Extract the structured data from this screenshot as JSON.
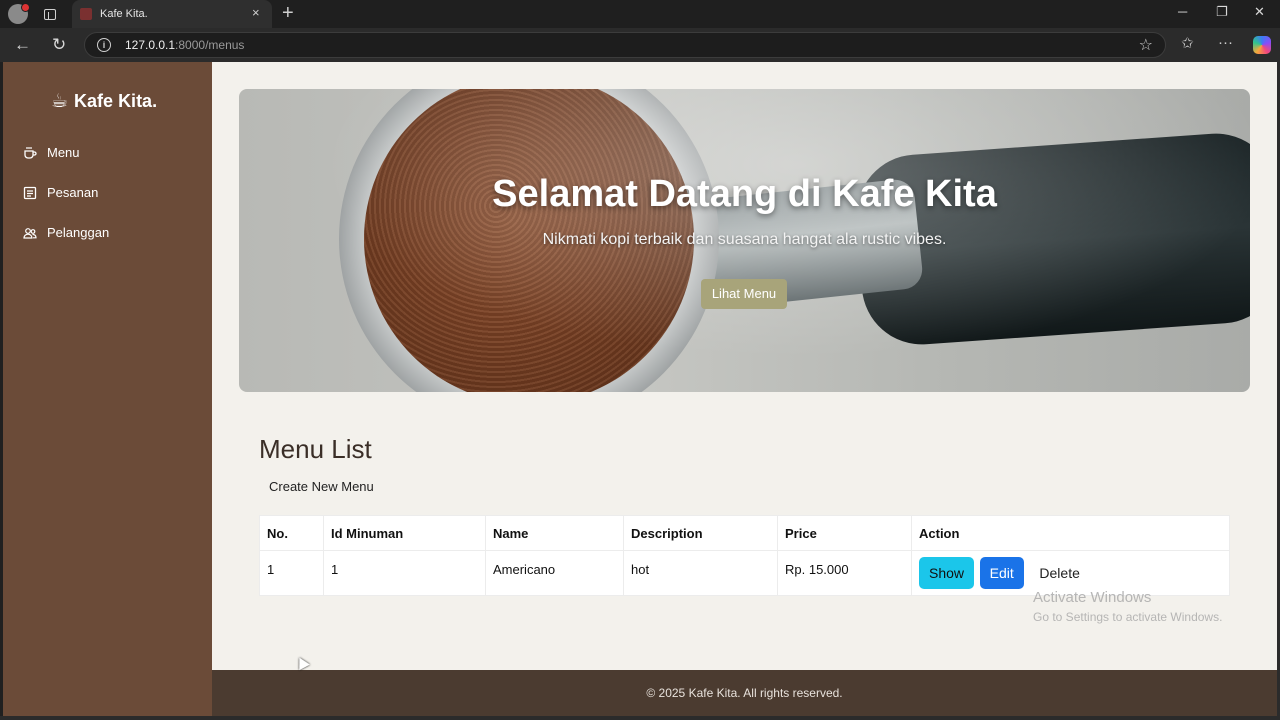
{
  "browser": {
    "tab_title": "Kafe Kita.",
    "tab_close": "×",
    "new_tab": "+",
    "url_host": "127.0.0.1",
    "url_rest": ":8000/menus",
    "info": "i",
    "star": "☆",
    "back": "←",
    "reload": "↻",
    "minimize": "─",
    "restore": "❐",
    "close": "✕",
    "favorites": "✩",
    "more": "···"
  },
  "sidebar": {
    "brand": "Kafe Kita.",
    "items": [
      {
        "label": "Menu",
        "icon": "coffee-cup-icon"
      },
      {
        "label": "Pesanan",
        "icon": "list-icon"
      },
      {
        "label": "Pelanggan",
        "icon": "users-icon"
      }
    ]
  },
  "hero": {
    "title": "Selamat Datang di Kafe Kita",
    "subtitle": "Nikmati kopi terbaik dan suasana hangat ala rustic vibes.",
    "button": "Lihat Menu"
  },
  "main": {
    "title": "Menu List",
    "create_link": "Create New Menu",
    "table": {
      "headers": [
        "No.",
        "Id Minuman",
        "Name",
        "Description",
        "Price",
        "Action"
      ],
      "rows": [
        {
          "no": "1",
          "id": "1",
          "name": "Americano",
          "description": "hot",
          "price": "Rp. 15.000"
        }
      ],
      "actions": {
        "show": "Show",
        "edit": "Edit",
        "delete": "Delete"
      }
    }
  },
  "footer": {
    "text": "© 2025 Kafe Kita. All rights reserved."
  },
  "watermark": {
    "line1": "Activate Windows",
    "line2": "Go to Settings to activate Windows."
  }
}
